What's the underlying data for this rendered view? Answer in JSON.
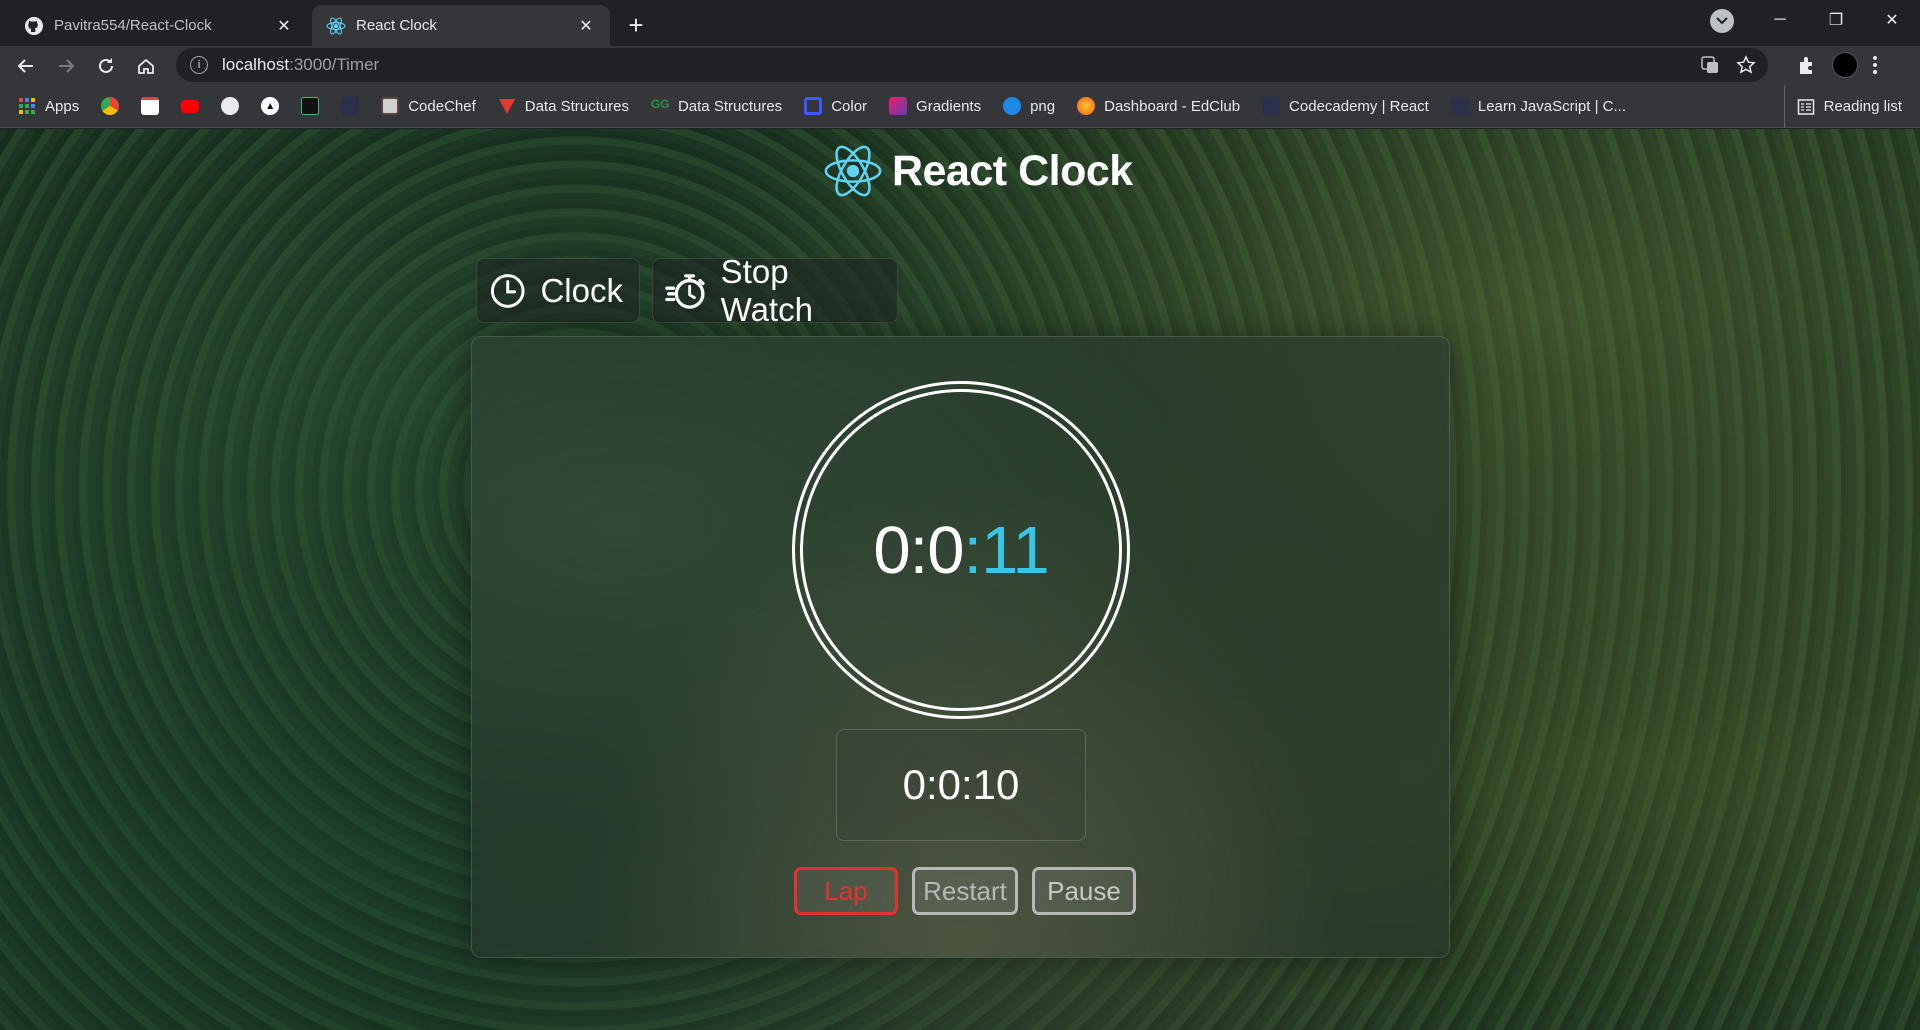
{
  "browser": {
    "tabs": [
      {
        "title": "Pavitra554/React-Clock",
        "active": false
      },
      {
        "title": "React Clock",
        "active": true
      }
    ],
    "address": {
      "host": "localhost",
      "path": ":3000/Timer"
    },
    "bookmarks": [
      {
        "label": "Apps",
        "icon": "apps-grid-icon"
      },
      {
        "label": "",
        "icon": "chrome-web-store-icon"
      },
      {
        "label": "",
        "icon": "gmail-icon"
      },
      {
        "label": "",
        "icon": "youtube-icon"
      },
      {
        "label": "",
        "icon": "github-icon"
      },
      {
        "label": "",
        "icon": "triangle-icon"
      },
      {
        "label": "",
        "icon": "hackerrank-icon"
      },
      {
        "label": "",
        "icon": "blank-page-icon"
      },
      {
        "label": "CodeChef",
        "icon": "codechef-icon"
      },
      {
        "label": "Data Structures",
        "icon": "data-structures-red-icon"
      },
      {
        "label": "Data Structures",
        "icon": "data-structures-green-icon"
      },
      {
        "label": "Color",
        "icon": "color-icon"
      },
      {
        "label": "Gradients",
        "icon": "gradients-icon"
      },
      {
        "label": "png",
        "icon": "png-icon"
      },
      {
        "label": "Dashboard - EdClub",
        "icon": "edclub-icon"
      },
      {
        "label": "Codecademy | React",
        "icon": "codecademy-icon"
      },
      {
        "label": "Learn JavaScript | C...",
        "icon": "learn-js-icon"
      }
    ],
    "reading_list": "Reading list"
  },
  "app": {
    "title": "React Clock",
    "modes": {
      "clock": "Clock",
      "stopwatch": "Stop Watch"
    },
    "stopwatch": {
      "time_main": "0:0",
      "time_sep": ":",
      "time_seconds": "11",
      "lap_time": "0:0:10"
    },
    "buttons": {
      "lap": "Lap",
      "restart": "Restart",
      "pause": "Pause"
    }
  },
  "colors": {
    "accent_seconds": "#38c6e8",
    "lap_button": "#e63030",
    "react_logo": "#5fd3f3"
  }
}
